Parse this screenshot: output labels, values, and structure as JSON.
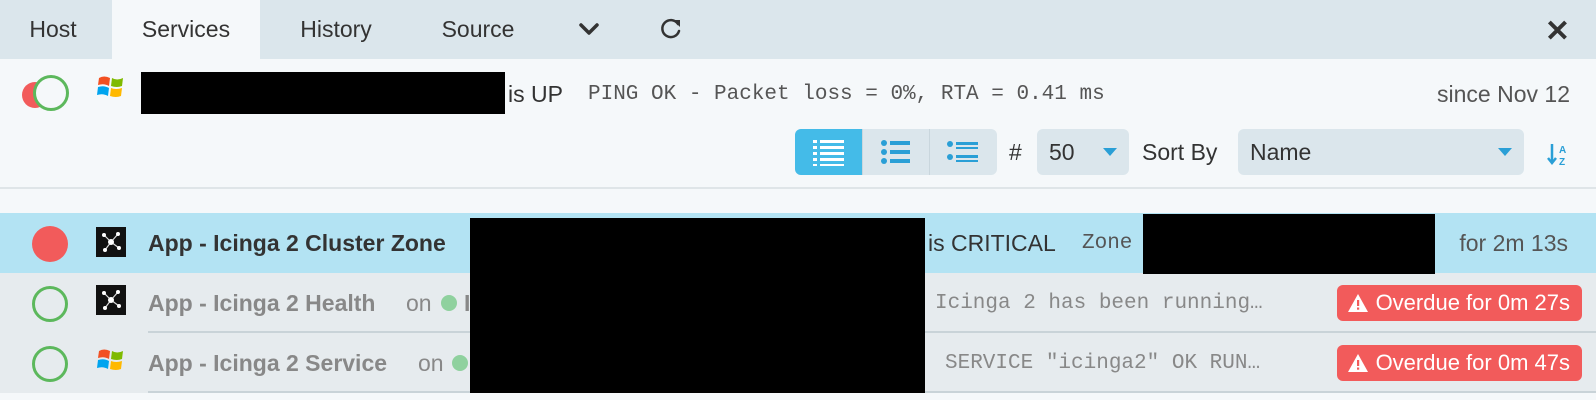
{
  "tabs": {
    "host": "Host",
    "services": "Services",
    "history": "History",
    "source": "Source"
  },
  "host": {
    "state_text": "is UP",
    "output": "PING OK - Packet loss = 0%, RTA = 0.41 ms",
    "since": "since Nov 12"
  },
  "controls": {
    "hash_label": "#",
    "limit_value": "50",
    "sort_label": "Sort By",
    "sort_value": "Name"
  },
  "services": [
    {
      "name": "App - Icinga 2 Cluster Zone",
      "state_text": "is CRITICAL",
      "output": "Zone",
      "duration": "for 2m 13s"
    },
    {
      "name": "App - Icinga 2 Health",
      "on_label": "on",
      "host_initial": "I",
      "output": "Icinga 2 has been running…",
      "badge": "Overdue for 0m 27s"
    },
    {
      "name": "App - Icinga 2 Service",
      "on_label": "on",
      "output": "SERVICE \"icinga2\" OK RUN…",
      "badge": "Overdue for 0m 47s"
    }
  ],
  "colors": {
    "ok": "#5cb85c",
    "critical": "#f25b5b",
    "selected_row": "#b3e3f3",
    "accent": "#44bbe8",
    "tabbar": "#dbe6ec"
  },
  "icons": [
    "dropdown-chevron-icon",
    "refresh-icon",
    "close-icon",
    "windows-icon",
    "icinga-node-icon",
    "sort-alpha-icon",
    "warning-icon"
  ]
}
